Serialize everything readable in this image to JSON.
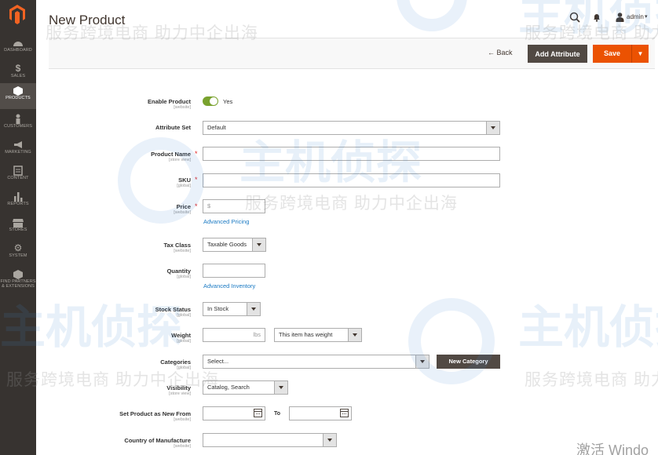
{
  "header": {
    "title": "New Product",
    "username": "admin"
  },
  "sidebar": {
    "items": [
      {
        "label": "DASHBOARD",
        "icon": "dashboard-icon"
      },
      {
        "label": "SALES",
        "icon": "dollar-icon"
      },
      {
        "label": "PRODUCTS",
        "icon": "cube-icon",
        "active": true
      },
      {
        "label": "CUSTOMERS",
        "icon": "person-icon"
      },
      {
        "label": "MARKETING",
        "icon": "megaphone-icon"
      },
      {
        "label": "CONTENT",
        "icon": "content-icon"
      },
      {
        "label": "REPORTS",
        "icon": "bar-chart-icon"
      },
      {
        "label": "STORES",
        "icon": "store-icon"
      },
      {
        "label": "SYSTEM",
        "icon": "gear-icon"
      },
      {
        "label_line1": "FIND PARTNERS",
        "label_line2": "& EXTENSIONS",
        "icon": "partners-icon"
      }
    ]
  },
  "actions": {
    "back": "← Back",
    "add_attribute": "Add Attribute",
    "save": "Save"
  },
  "form": {
    "enable_product": {
      "label": "Enable Product",
      "scope": "[website]",
      "value": "Yes"
    },
    "attribute_set": {
      "label": "Attribute Set",
      "value": "Default"
    },
    "product_name": {
      "label": "Product Name",
      "scope": "[store view]",
      "value": ""
    },
    "sku": {
      "label": "SKU",
      "scope": "[global]",
      "value": ""
    },
    "price": {
      "label": "Price",
      "scope": "[website]",
      "prefix": "$",
      "link": "Advanced Pricing"
    },
    "tax_class": {
      "label": "Tax Class",
      "scope": "[website]",
      "value": "Taxable Goods"
    },
    "quantity": {
      "label": "Quantity",
      "scope": "[global]",
      "value": "",
      "link": "Advanced Inventory"
    },
    "stock_status": {
      "label": "Stock Status",
      "scope": "[global]",
      "value": "In Stock"
    },
    "weight": {
      "label": "Weight",
      "scope": "[global]",
      "unit": "lbs",
      "type_value": "This item has weight"
    },
    "categories": {
      "label": "Categories",
      "scope": "[global]",
      "placeholder": "Select...",
      "button": "New Category"
    },
    "visibility": {
      "label": "Visibility",
      "scope": "[store view]",
      "value": "Catalog, Search"
    },
    "new_from": {
      "label": "Set Product as New From",
      "scope": "[website]",
      "to_label": "To"
    },
    "country": {
      "label": "Country of Manufacture",
      "scope": "[website]",
      "value": ""
    }
  },
  "watermark": {
    "text": "服务跨境电商 助力中企出海",
    "logo_text": "主机侦探",
    "activate": "激活 Windo"
  },
  "colors": {
    "sidebar_bg": "#373330",
    "accent_orange": "#eb5202",
    "button_dark": "#514943",
    "toggle_green": "#79a22e",
    "link_blue": "#1979c3",
    "required_red": "#e22626"
  }
}
